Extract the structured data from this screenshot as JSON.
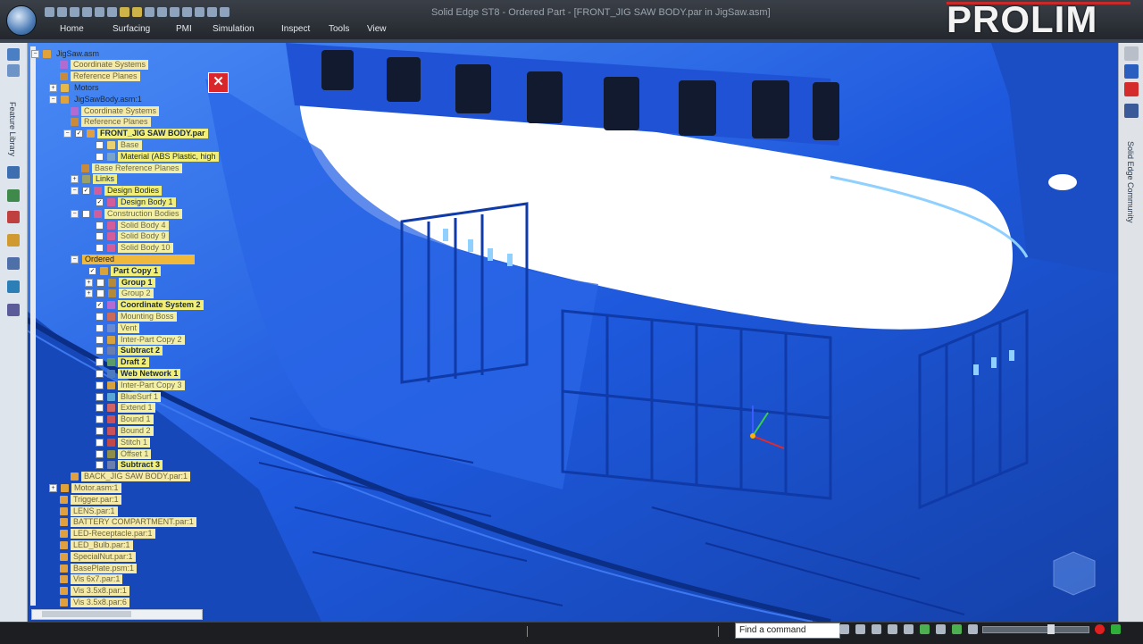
{
  "window": {
    "title": "Solid Edge ST8 - Ordered Part - [FRONT_JIG SAW BODY.par in JigSaw.asm]",
    "logo_text": "PROLIM"
  },
  "ribbon": {
    "tabs": [
      "Home",
      "Surfacing",
      "PMI",
      "Simulation",
      "Inspect",
      "Tools",
      "View"
    ]
  },
  "left_toolbar": {
    "label": "Feature Library"
  },
  "right_toolbar": {
    "label": "Solid Edge Community"
  },
  "tree": {
    "rows": [
      {
        "label": "JigSaw.asm",
        "style": "plain",
        "icon": "assembly-icon"
      },
      {
        "label": "Coordinate Systems",
        "style": "dim",
        "icon": "coordinate-icon"
      },
      {
        "label": "Reference Planes",
        "style": "dim",
        "icon": "plane-icon"
      },
      {
        "label": "Motors",
        "style": "plain",
        "icon": "folder-icon"
      },
      {
        "label": "JigSawBody.asm:1",
        "style": "plain",
        "icon": "assembly-icon"
      },
      {
        "label": "Coordinate Systems",
        "style": "dim",
        "icon": "coordinate-icon"
      },
      {
        "label": "Reference Planes",
        "style": "dim",
        "icon": "plane-icon"
      },
      {
        "label": "FRONT_JIG SAW BODY.par",
        "style": "hl-bold",
        "icon": "part-icon"
      },
      {
        "label": "Base",
        "style": "hl-dim",
        "icon": "base-icon"
      },
      {
        "label": "Material (ABS Plastic, high",
        "style": "hl",
        "icon": "material-icon"
      },
      {
        "label": "Base Reference Planes",
        "style": "hl-dim",
        "icon": "plane-icon"
      },
      {
        "label": "Links",
        "style": "hl",
        "icon": "link-icon"
      },
      {
        "label": "Design Bodies",
        "style": "hl",
        "icon": "body-icon"
      },
      {
        "label": "Design Body 1",
        "style": "hl",
        "icon": "body-icon"
      },
      {
        "label": "Construction Bodies",
        "style": "hl-dim",
        "icon": "body-icon"
      },
      {
        "label": "Solid Body 4",
        "style": "hl-dim",
        "icon": "body-icon"
      },
      {
        "label": "Solid Body 9",
        "style": "hl-dim",
        "icon": "body-icon"
      },
      {
        "label": "Solid Body 10",
        "style": "hl-dim",
        "icon": "body-icon"
      },
      {
        "label": "Ordered",
        "style": "sel",
        "icon": "none"
      },
      {
        "label": "Part Copy 1",
        "style": "hl-bold",
        "icon": "copy-icon"
      },
      {
        "label": "Group 1",
        "style": "hl-bold",
        "icon": "group-icon"
      },
      {
        "label": "Group 2",
        "style": "hl-dim",
        "icon": "group-icon"
      },
      {
        "label": "Coordinate System 2",
        "style": "hl-bold",
        "icon": "coordinate-icon"
      },
      {
        "label": "Mounting Boss",
        "style": "hl-dim",
        "icon": "boss-icon"
      },
      {
        "label": "Vent",
        "style": "hl-dim",
        "icon": "vent-icon"
      },
      {
        "label": "Inter-Part Copy 2",
        "style": "hl-dim",
        "icon": "copy-icon"
      },
      {
        "label": "Subtract 2",
        "style": "hl-bold",
        "icon": "subtract-icon"
      },
      {
        "label": "Draft 2",
        "style": "hl-bold",
        "icon": "draft-icon"
      },
      {
        "label": "Web Network 1",
        "style": "hl-bold",
        "icon": "web-icon"
      },
      {
        "label": "Inter-Part Copy 3",
        "style": "hl-dim",
        "icon": "copy-icon"
      },
      {
        "label": "BlueSurf 1",
        "style": "hl-dim",
        "icon": "surface-icon"
      },
      {
        "label": "Extend 1",
        "style": "hl-dim",
        "icon": "extend-icon"
      },
      {
        "label": "Bound 1",
        "style": "hl-dim",
        "icon": "bound-icon"
      },
      {
        "label": "Bound 2",
        "style": "hl-dim",
        "icon": "bound-icon"
      },
      {
        "label": "Stitch 1",
        "style": "hl-dim",
        "icon": "stitch-icon"
      },
      {
        "label": "Offset 1",
        "style": "hl-dim",
        "icon": "offset-icon"
      },
      {
        "label": "Subtract 3",
        "style": "hl-bold",
        "icon": "subtract-icon"
      },
      {
        "label": "BACK_JIG SAW BODY.par:1",
        "style": "dim",
        "icon": "part-icon"
      },
      {
        "label": "Motor.asm:1",
        "style": "dim",
        "icon": "assembly-icon"
      },
      {
        "label": "Trigger.par:1",
        "style": "dim",
        "icon": "part-icon"
      },
      {
        "label": "LENS.par:1",
        "style": "dim",
        "icon": "part-icon"
      },
      {
        "label": "BATTERY COMPARTMENT.par:1",
        "style": "dim",
        "icon": "part-icon"
      },
      {
        "label": "LED-Receptacle.par:1",
        "style": "dim",
        "icon": "part-icon"
      },
      {
        "label": "LED_Bulb.par:1",
        "style": "dim",
        "icon": "part-icon"
      },
      {
        "label": "SpecialNut.par:1",
        "style": "dim",
        "icon": "part-icon"
      },
      {
        "label": "BasePlate.psm:1",
        "style": "dim",
        "icon": "part-icon"
      },
      {
        "label": "Vis 6x7.par:1",
        "style": "dim",
        "icon": "part-icon"
      },
      {
        "label": "Vis 3.5x8.par:1",
        "style": "dim",
        "icon": "part-icon"
      },
      {
        "label": "Vis 3.5x8.par:6",
        "style": "dim",
        "icon": "part-icon"
      }
    ]
  },
  "status_bar": {
    "command_placeholder": "Find a command"
  },
  "colors": {
    "model_blue": "#1f5de0",
    "highlight_yellow": "#f1ef7a",
    "selected_orange": "#f1b93c",
    "close_red": "#d9262a"
  }
}
